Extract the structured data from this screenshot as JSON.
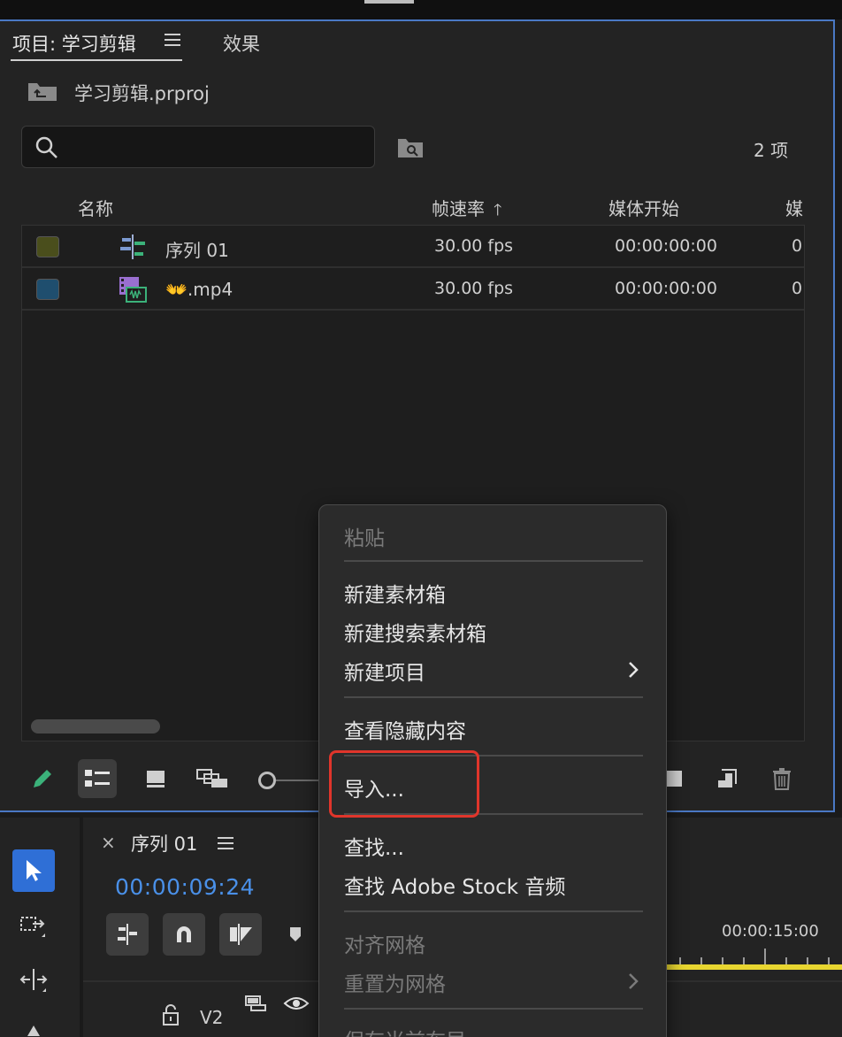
{
  "project_panel": {
    "tab_project_label": "项目: 学习剪辑",
    "tab_effects_label": "效果",
    "project_file": "学习剪辑.prproj",
    "search_placeholder": "",
    "item_count": "2 项",
    "columns": {
      "name": "名称",
      "frame_rate": "帧速率",
      "media_start": "媒体开始",
      "media_truncated": "媒"
    },
    "rows": [
      {
        "swatch_color": "#4a4e1c",
        "name": "序列 01",
        "fps": "30.00 fps",
        "start": "00:00:00:00",
        "extra": "0",
        "icon": "sequence-icon"
      },
      {
        "swatch_color": "#1f4e6e",
        "name": "👐.mp4",
        "fps": "30.00 fps",
        "start": "00:00:00:00",
        "extra": "0",
        "icon": "video-clip-icon"
      }
    ]
  },
  "timeline_panel": {
    "title": "序列 01",
    "close_glyph": "×",
    "timecode": "00:00:09:24",
    "ruler_time": "00:00:15:00",
    "track_label": "V2"
  },
  "context_menu": {
    "items": [
      {
        "label": "粘贴",
        "disabled": true
      },
      {
        "label": "新建素材箱",
        "disabled": false
      },
      {
        "label": "新建搜索素材箱",
        "disabled": false
      },
      {
        "label": "新建项目",
        "disabled": false,
        "submenu": true
      },
      {
        "label": "查看隐藏内容",
        "disabled": false
      },
      {
        "label": "导入...",
        "disabled": false,
        "highlighted": true
      },
      {
        "label": "查找...",
        "disabled": false
      },
      {
        "label": "查找 Adobe Stock 音频",
        "disabled": false
      },
      {
        "label": "对齐网格",
        "disabled": true
      },
      {
        "label": "重置为网格",
        "disabled": true,
        "submenu": true
      },
      {
        "label": "保存当前布局",
        "disabled": true
      }
    ]
  },
  "colors": {
    "accent_blue": "#4a78c4",
    "timecode_blue": "#4a90e8",
    "highlight_red": "#e0352b",
    "work_area_yellow": "#e8d630",
    "tool_active_blue": "#2f6fd6"
  }
}
